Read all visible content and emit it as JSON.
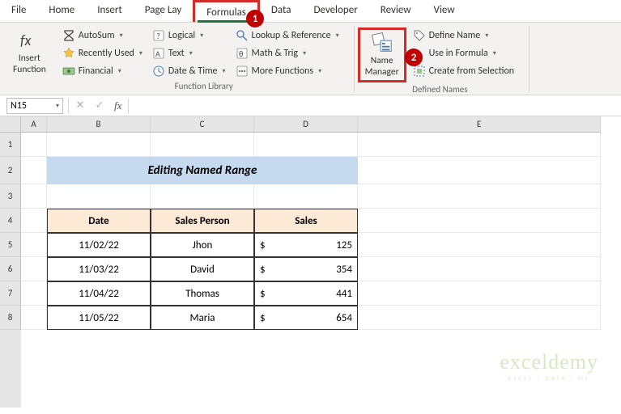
{
  "tabs": {
    "file": "File",
    "home": "Home",
    "insert": "Insert",
    "pagelay": "Page Lay",
    "formulas": "Formulas",
    "data": "Data",
    "developer": "Developer",
    "review": "Review",
    "view": "View"
  },
  "callouts": {
    "one": "1",
    "two": "2"
  },
  "ribbon": {
    "insertFn": "Insert\nFunction",
    "autosum": "AutoSum",
    "recentlyUsed": "Recently Used",
    "financial": "Financial",
    "logical": "Logical",
    "text": "Text",
    "dateTime": "Date & Time",
    "lookupRef": "Lookup & Reference",
    "mathTrig": "Math & Trig",
    "moreFn": "More Functions",
    "groupFnLib": "Function Library",
    "nameMgr": "Name\nManager",
    "defineName": "Define Name",
    "useInFormula": "Use in Formula",
    "createFromSel": "Create from Selection",
    "groupDefNames": "Defined Names"
  },
  "formulaBar": {
    "nameBox": "N15",
    "cancel": "✕",
    "enter": "✓",
    "fx": "fx"
  },
  "cols": {
    "A": "A",
    "B": "B",
    "C": "C",
    "D": "D",
    "E": "E"
  },
  "rows": {
    "1": "1",
    "2": "2",
    "3": "3",
    "4": "4",
    "5": "5",
    "6": "6",
    "7": "7",
    "8": "8"
  },
  "sheet": {
    "title": "Editing Named Range",
    "headers": {
      "date": "Date",
      "salesPerson": "Sales Person",
      "sales": "Sales"
    },
    "currency": "$",
    "rows": [
      {
        "date": "11/02/22",
        "person": "Jhon",
        "sales": "125"
      },
      {
        "date": "11/03/22",
        "person": "David",
        "sales": "354"
      },
      {
        "date": "11/04/22",
        "person": "Thomas",
        "sales": "441"
      },
      {
        "date": "11/05/22",
        "person": "Maria",
        "sales": "654"
      }
    ]
  },
  "watermark": {
    "brand": "exceldemy",
    "tag": "EXCEL · DATA · ML"
  }
}
